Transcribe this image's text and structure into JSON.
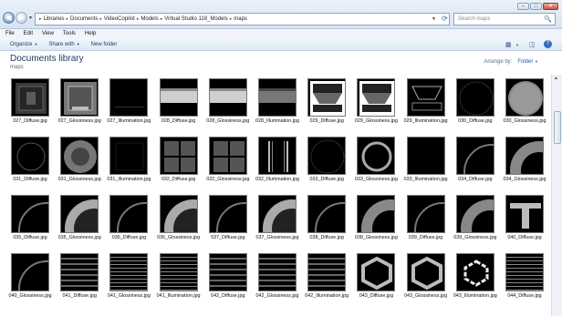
{
  "titlebar": {
    "back_glyph": "◀",
    "forward_glyph": "▶",
    "dropdown_glyph": "▼",
    "breadcrumbs": [
      "Libraries",
      "Documents",
      "VideoCopilot",
      "Models",
      "Virtual Studio 118_Models",
      "maps"
    ],
    "separator": "▸",
    "refresh_glyph": "⟳",
    "search_placeholder": "Search maps",
    "search_icon": "🔍",
    "min_glyph": "‒",
    "max_glyph": "□",
    "close_glyph": "✕"
  },
  "menu": [
    "File",
    "Edit",
    "View",
    "Tools",
    "Help"
  ],
  "toolbar": {
    "organize": "Organize",
    "share_with": "Share with",
    "new_folder": "New folder",
    "caret": "▼",
    "view_icon": "▦",
    "pane_icon": "◫",
    "help_icon": "?"
  },
  "library": {
    "title": "Documents library",
    "subtitle": "maps",
    "arrange_label": "Arrange by:",
    "arrange_value": "Folder"
  },
  "scroll": {
    "up": "▲"
  },
  "files": [
    {
      "name": "027_Diffuse.jpg",
      "art": "panel-diffuse"
    },
    {
      "name": "027_Glossiness.jpg",
      "art": "panel-gloss"
    },
    {
      "name": "027_Illumination.jpg",
      "art": "dark-line"
    },
    {
      "name": "028_Diffuse.jpg",
      "art": "bar"
    },
    {
      "name": "028_Glossiness.jpg",
      "art": "bar"
    },
    {
      "name": "028_Illumination.jpg",
      "art": "bar-dark"
    },
    {
      "name": "029_Diffuse.jpg",
      "art": "hatch"
    },
    {
      "name": "029_Glossiness.jpg",
      "art": "hatch"
    },
    {
      "name": "029_Illumination.jpg",
      "art": "hatch-dark"
    },
    {
      "name": "030_Diffuse.jpg",
      "art": "dotted-circle"
    },
    {
      "name": "030_Glossiness.jpg",
      "art": "gray-circle"
    },
    {
      "name": "031_Diffuse.jpg",
      "art": "ring-corner"
    },
    {
      "name": "031_Glossiness.jpg",
      "art": "ring-gray"
    },
    {
      "name": "031_Illumination.jpg",
      "art": "dark-grid"
    },
    {
      "name": "032_Diffuse.jpg",
      "art": "quad"
    },
    {
      "name": "032_Glossiness.jpg",
      "art": "quad"
    },
    {
      "name": "032_Illumination.jpg",
      "art": "quad-lines"
    },
    {
      "name": "033_Diffuse.jpg",
      "art": "dotted-circle"
    },
    {
      "name": "033_Glossiness.jpg",
      "art": "ring"
    },
    {
      "name": "033_Illumination.jpg",
      "art": "dark"
    },
    {
      "name": "034_Diffuse.jpg",
      "art": "arc"
    },
    {
      "name": "034_Glossiness.jpg",
      "art": "arc-gray"
    },
    {
      "name": "035_Diffuse.jpg",
      "art": "arc"
    },
    {
      "name": "035_Glossiness.jpg",
      "art": "arc-light"
    },
    {
      "name": "036_Diffuse.jpg",
      "art": "arc"
    },
    {
      "name": "036_Glossiness.jpg",
      "art": "arc-light"
    },
    {
      "name": "037_Diffuse.jpg",
      "art": "arc"
    },
    {
      "name": "037_Glossiness.jpg",
      "art": "arc-light"
    },
    {
      "name": "038_Diffuse.jpg",
      "art": "arc"
    },
    {
      "name": "038_Glossiness.jpg",
      "art": "arc-gray"
    },
    {
      "name": "039_Diffuse.jpg",
      "art": "arc"
    },
    {
      "name": "039_Glossiness.jpg",
      "art": "arc-gray"
    },
    {
      "name": "040_Diffuse.jpg",
      "art": "tee"
    },
    {
      "name": "040_Glossiness.jpg",
      "art": "arc"
    },
    {
      "name": "041_Diffuse.jpg",
      "art": "stripes"
    },
    {
      "name": "041_Glossiness.jpg",
      "art": "stripes-fine"
    },
    {
      "name": "041_Illumination.jpg",
      "art": "stripes-fine"
    },
    {
      "name": "042_Diffuse.jpg",
      "art": "stripes"
    },
    {
      "name": "042_Glossiness.jpg",
      "art": "stripes"
    },
    {
      "name": "042_Illumination.jpg",
      "art": "stripes"
    },
    {
      "name": "043_Diffuse.jpg",
      "art": "hex"
    },
    {
      "name": "043_Glossiness.jpg",
      "art": "hex"
    },
    {
      "name": "043_Illumination.jpg",
      "art": "hex-light"
    },
    {
      "name": "044_Diffuse.jpg",
      "art": "stripes-fine"
    }
  ]
}
